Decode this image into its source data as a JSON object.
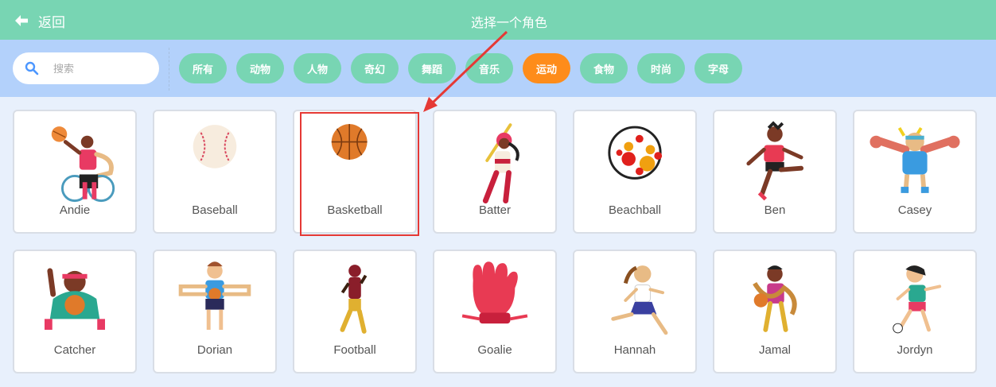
{
  "header": {
    "back_label": "返回",
    "title": "选择一个角色"
  },
  "search": {
    "placeholder": "搜索",
    "value": ""
  },
  "tags": [
    {
      "label": "所有",
      "active": false
    },
    {
      "label": "动物",
      "active": false
    },
    {
      "label": "人物",
      "active": false
    },
    {
      "label": "奇幻",
      "active": false
    },
    {
      "label": "舞蹈",
      "active": false
    },
    {
      "label": "音乐",
      "active": false
    },
    {
      "label": "运动",
      "active": true
    },
    {
      "label": "食物",
      "active": false
    },
    {
      "label": "时尚",
      "active": false
    },
    {
      "label": "字母",
      "active": false
    }
  ],
  "sprites": [
    {
      "name": "Andie"
    },
    {
      "name": "Baseball"
    },
    {
      "name": "Basketball",
      "highlighted": true
    },
    {
      "name": "Batter"
    },
    {
      "name": "Beachball"
    },
    {
      "name": "Ben"
    },
    {
      "name": "Casey"
    },
    {
      "name": "Catcher"
    },
    {
      "name": "Dorian"
    },
    {
      "name": "Football"
    },
    {
      "name": "Goalie"
    },
    {
      "name": "Hannah"
    },
    {
      "name": "Jamal"
    },
    {
      "name": "Jordyn"
    }
  ],
  "colors": {
    "header_bg": "#78d5b3",
    "filter_bg": "#b3d1fb",
    "tag_bg": "#78d5b3",
    "tag_active_bg": "#fe8c1a",
    "annotation_red": "#e53935"
  }
}
